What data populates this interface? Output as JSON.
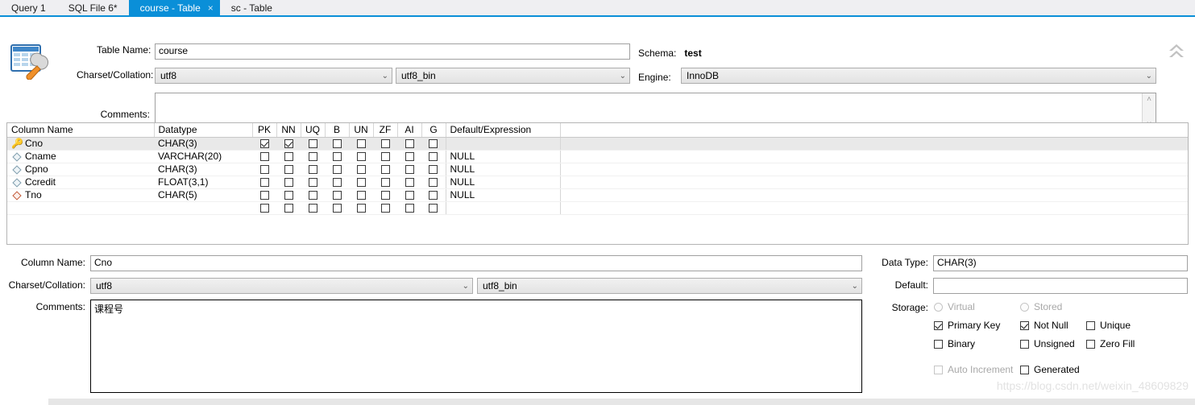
{
  "tabs": [
    {
      "label": "Query 1",
      "active": false,
      "closable": false
    },
    {
      "label": "SQL File 6*",
      "active": false,
      "closable": false
    },
    {
      "label": "course - Table",
      "active": true,
      "closable": true,
      "close_glyph": "×"
    },
    {
      "label": "sc - Table",
      "active": false,
      "closable": false
    }
  ],
  "table_form": {
    "icon": "table-wrench-icon",
    "table_name_label": "Table Name:",
    "table_name_value": "course",
    "schema_label": "Schema:",
    "schema_value": "test",
    "charset_label": "Charset/Collation:",
    "charset_value": "utf8",
    "collation_value": "utf8_bin",
    "engine_label": "Engine:",
    "engine_value": "InnoDB",
    "comments_label": "Comments:",
    "comments_value": "",
    "collapse_icon": "chevron-double-up-icon",
    "chevron_glyph": "⌄",
    "scroll_up_glyph": "˄",
    "scroll_down_glyph": "˅"
  },
  "columns_grid": {
    "headers": [
      "Column Name",
      "Datatype",
      "PK",
      "NN",
      "UQ",
      "B",
      "UN",
      "ZF",
      "AI",
      "G",
      "Default/Expression"
    ],
    "rows": [
      {
        "icon": "primary-key-icon",
        "name": "Cno",
        "datatype": "CHAR(3)",
        "pk": true,
        "nn": true,
        "uq": false,
        "b": false,
        "un": false,
        "zf": false,
        "ai": false,
        "g": false,
        "def": "",
        "selected": true
      },
      {
        "icon": "column-icon",
        "name": "Cname",
        "datatype": "VARCHAR(20)",
        "pk": false,
        "nn": false,
        "uq": false,
        "b": false,
        "un": false,
        "zf": false,
        "ai": false,
        "g": false,
        "def": "NULL",
        "selected": false
      },
      {
        "icon": "column-icon",
        "name": "Cpno",
        "datatype": "CHAR(3)",
        "pk": false,
        "nn": false,
        "uq": false,
        "b": false,
        "un": false,
        "zf": false,
        "ai": false,
        "g": false,
        "def": "NULL",
        "selected": false
      },
      {
        "icon": "column-icon",
        "name": "Ccredit",
        "datatype": "FLOAT(3,1)",
        "pk": false,
        "nn": false,
        "uq": false,
        "b": false,
        "un": false,
        "zf": false,
        "ai": false,
        "g": false,
        "def": "NULL",
        "selected": false
      },
      {
        "icon": "foreign-key-icon",
        "name": "Tno",
        "datatype": "CHAR(5)",
        "pk": false,
        "nn": false,
        "uq": false,
        "b": false,
        "un": false,
        "zf": false,
        "ai": false,
        "g": false,
        "def": "NULL",
        "selected": false
      },
      {
        "icon": "",
        "name": "",
        "datatype": "",
        "pk": false,
        "nn": false,
        "uq": false,
        "b": false,
        "un": false,
        "zf": false,
        "ai": false,
        "g": false,
        "def": "",
        "selected": false
      }
    ]
  },
  "column_detail": {
    "column_name_label": "Column Name:",
    "column_name_value": "Cno",
    "charset_label": "Charset/Collation:",
    "charset_value": "utf8",
    "collation_value": "utf8_bin",
    "comments_label": "Comments:",
    "comments_value": "课程号",
    "data_type_label": "Data Type:",
    "data_type_value": "CHAR(3)",
    "default_label": "Default:",
    "default_value": "",
    "storage_label": "Storage:",
    "options": [
      {
        "label": "Virtual",
        "type": "radio",
        "checked": false,
        "disabled": true
      },
      {
        "label": "Stored",
        "type": "radio",
        "checked": false,
        "disabled": true
      },
      {
        "label": "Primary Key",
        "type": "checkbox",
        "checked": true,
        "disabled": false
      },
      {
        "label": "Not Null",
        "type": "checkbox",
        "checked": true,
        "disabled": false
      },
      {
        "label": "Unique",
        "type": "checkbox",
        "checked": false,
        "disabled": false
      },
      {
        "label": "Binary",
        "type": "checkbox",
        "checked": false,
        "disabled": false
      },
      {
        "label": "Unsigned",
        "type": "checkbox",
        "checked": false,
        "disabled": false
      },
      {
        "label": "Zero Fill",
        "type": "checkbox",
        "checked": false,
        "disabled": false
      },
      {
        "label": "Auto Increment",
        "type": "checkbox",
        "checked": false,
        "disabled": true
      },
      {
        "label": "Generated",
        "type": "checkbox",
        "checked": false,
        "disabled": false
      }
    ]
  },
  "watermark": "https://blog.csdn.net/weixin_48609829",
  "colors": {
    "active_tab": "#0a8fd8",
    "tabbar_bg": "#efeff2",
    "key_icon": "#e8bc24",
    "fk_icon": "#c25b3a",
    "col_icon": "#7f9dad"
  }
}
